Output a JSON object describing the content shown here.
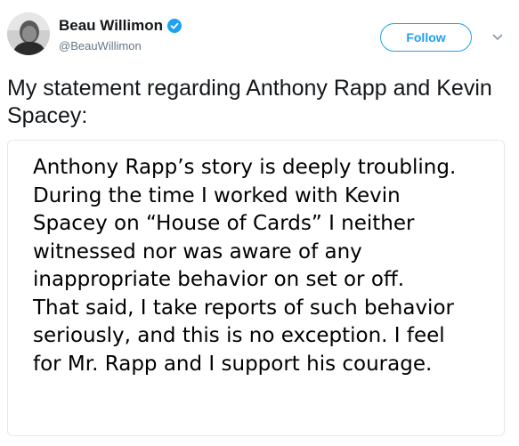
{
  "author": {
    "display_name": "Beau Willimon",
    "handle": "@BeauWillimon",
    "verified": true,
    "avatar_icon": "user-photo-avatar"
  },
  "actions": {
    "follow_label": "Follow",
    "menu_icon": "chevron-down-icon"
  },
  "tweet": {
    "text": "My statement regarding Anthony Rapp and Kevin Spacey:"
  },
  "media": {
    "lines": [
      "Anthony Rapp’s story is deeply troubling.",
      "During the time I worked with Kevin",
      "Spacey on “House of Cards” I neither",
      "witnessed nor was aware of any",
      "inappropriate behavior on set or off.",
      "That said, I take reports of such behavior",
      "seriously, and this is no exception. I feel",
      "for Mr. Rapp and I support his courage."
    ]
  },
  "colors": {
    "accent": "#1da1f2",
    "secondary_text": "#657786",
    "border": "#e1e8ed"
  }
}
